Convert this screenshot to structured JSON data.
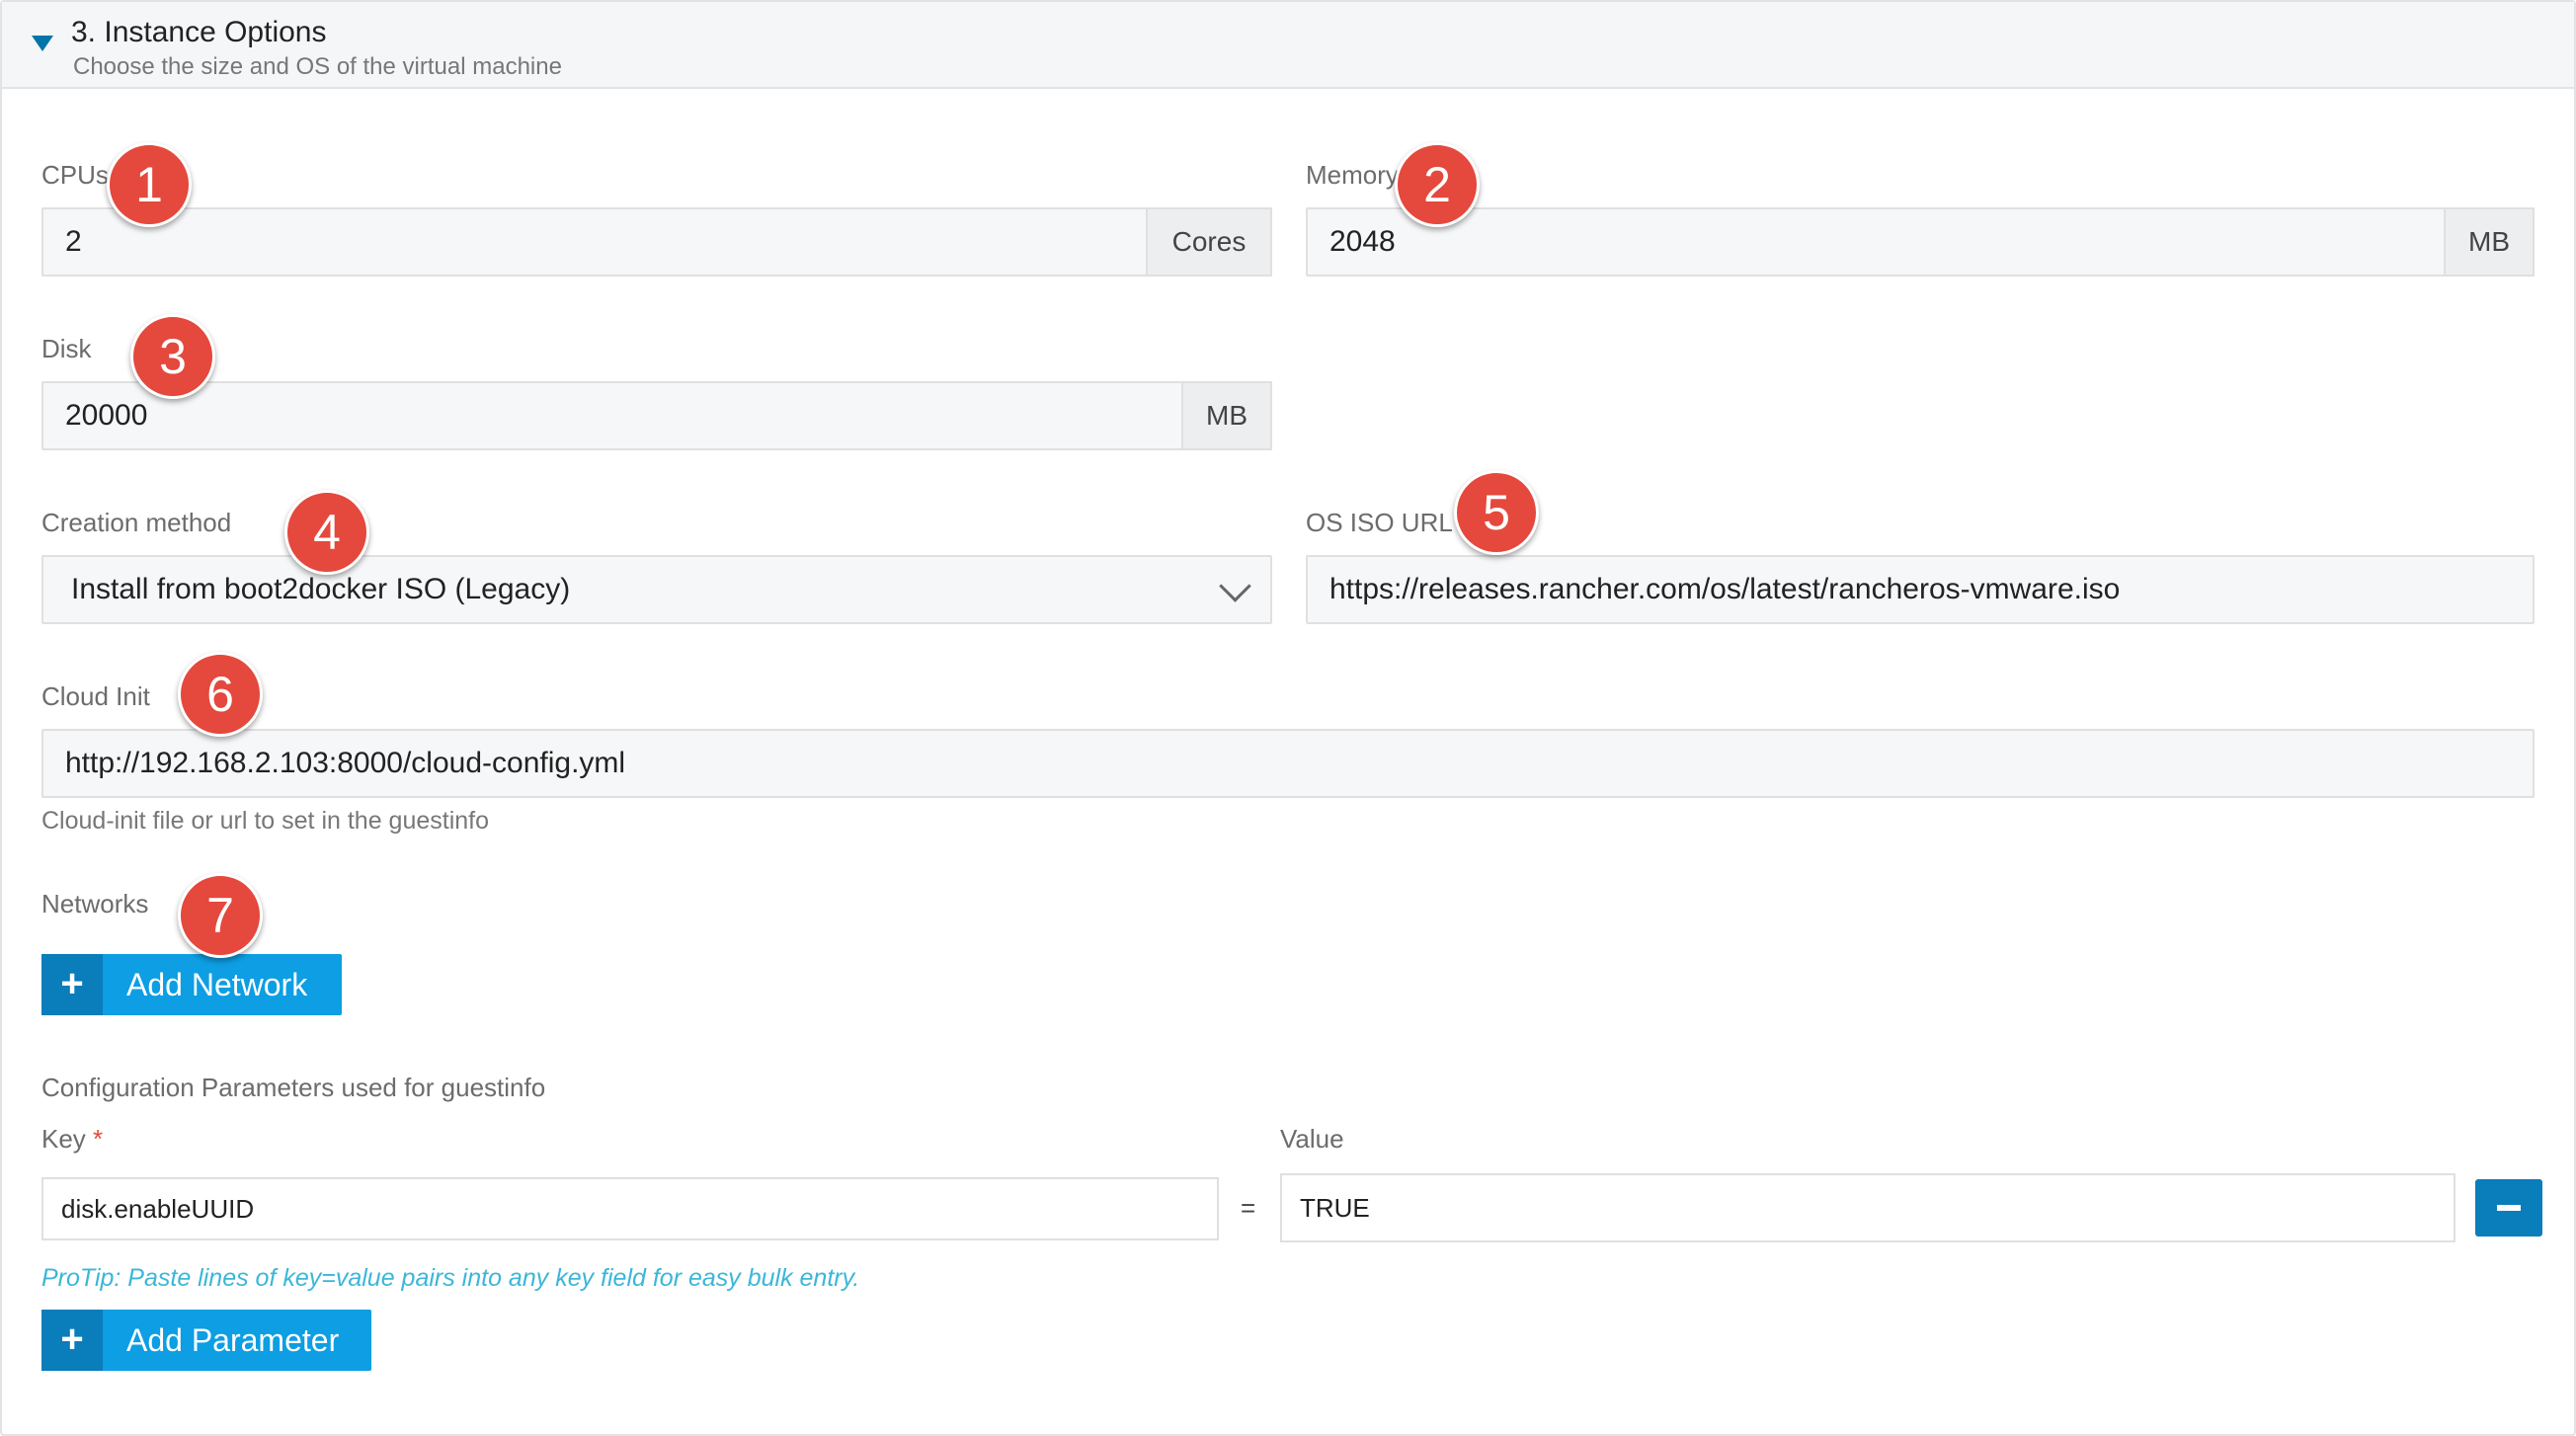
{
  "section": {
    "title": "3. Instance Options",
    "subtitle": "Choose the size and OS of the virtual machine"
  },
  "cpus": {
    "label": "CPUs",
    "value": "2",
    "unit": "Cores",
    "badge": "1"
  },
  "memory": {
    "label": "Memory",
    "value": "2048",
    "unit": "MB",
    "badge": "2"
  },
  "disk": {
    "label": "Disk",
    "value": "20000",
    "unit": "MB",
    "badge": "3"
  },
  "creation": {
    "label": "Creation method",
    "value": "Install from boot2docker ISO (Legacy)",
    "badge": "4"
  },
  "os_iso": {
    "label": "OS ISO URL",
    "value": "https://releases.rancher.com/os/latest/rancheros-vmware.iso",
    "badge": "5"
  },
  "cloud_init": {
    "label": "Cloud Init",
    "value": "http://192.168.2.103:8000/cloud-config.yml",
    "help": "Cloud-init file or url to set in the guestinfo",
    "badge": "6"
  },
  "networks": {
    "label": "Networks",
    "add_button": "Add Network",
    "badge": "7"
  },
  "config": {
    "label": "Configuration Parameters used for guestinfo",
    "key_label": "Key",
    "required_mark": "*",
    "value_label": "Value",
    "rows": [
      {
        "key": "disk.enableUUID",
        "eq": "=",
        "value": "TRUE"
      }
    ],
    "protip": "ProTip: Paste lines of key=value pairs into any key field for easy bulk entry.",
    "add_button": "Add Parameter"
  },
  "icons": {
    "expand": "caret-down-icon",
    "add": "plus-icon",
    "remove": "minus-icon",
    "dropdown": "chevron-down-icon"
  },
  "colors": {
    "accent": "#0d9ee3",
    "badge": "#e5483c",
    "protip": "#3cb6d9"
  }
}
